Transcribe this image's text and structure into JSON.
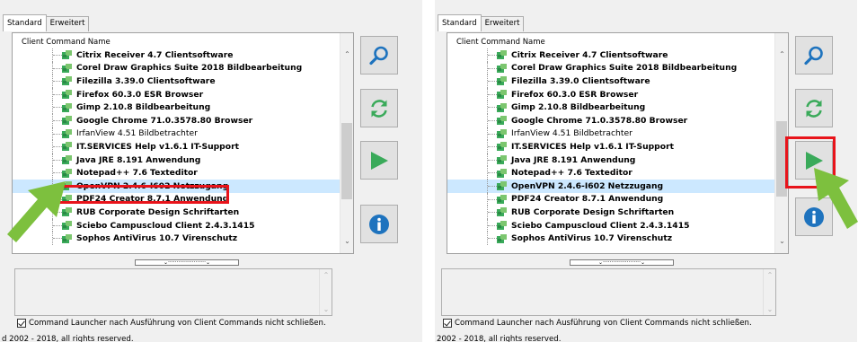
{
  "tabs": [
    "Standard",
    "Erweitert"
  ],
  "tree": {
    "header": "Client Command Name",
    "items": [
      "Citrix Receiver 4.7 Clientsoftware",
      "Corel Draw Graphics Suite 2018 Bildbearbeitung",
      "Filezilla 3.39.0 Clientsoftware",
      "Firefox 60.3.0 ESR Browser",
      "Gimp 2.10.8 Bildbearbeitung",
      "Google Chrome 71.0.3578.80 Browser",
      "IrfanView 4.51 Bildbetrachter",
      "IT.SERVICES Help v1.6.1 IT-Support",
      "Java JRE 8.191 Anwendung",
      "Notepad++ 7.6 Texteditor",
      "OpenVPN 2.4.6-I602 Netzzugang",
      "PDF24 Creator 8.7.1 Anwendung",
      "RUB Corporate Design Schriftarten",
      "Sciebo Campuscloud Client 2.4.3.1415",
      "Sophos AntiVirus 10.7 Virenschutz"
    ],
    "selected_index": 10,
    "plain_index": 6
  },
  "checkbox_label": "Command Launcher nach Ausführung von Client Commands nicht schließen.",
  "copyright_left": "d 2002 - 2018, all rights reserved.",
  "copyright_right": "2002 - 2018, all rights reserved.",
  "icons": {
    "search": "search-icon",
    "refresh": "refresh-icon",
    "run": "play-icon",
    "info": "info-icon",
    "package": "package-icon"
  },
  "colors": {
    "blue": "#1e73be",
    "green": "#3aaa5a",
    "selection": "#cce8ff",
    "highlight": "#e8141b",
    "annotation_arrow": "#7dc03e"
  }
}
